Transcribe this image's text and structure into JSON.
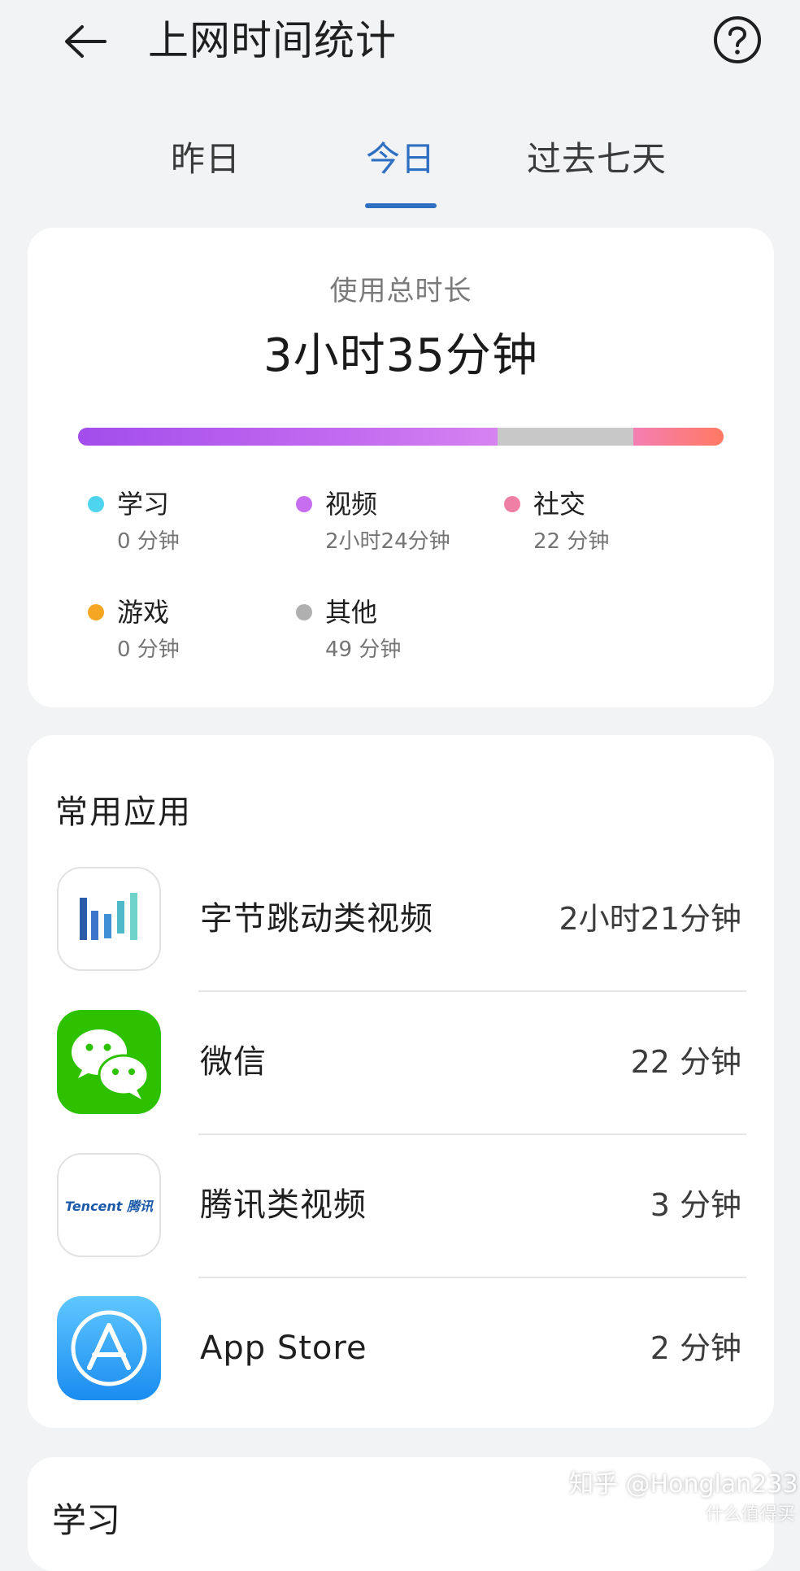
{
  "header": {
    "title": "上网时间统计",
    "back_icon": "arrow-left-icon",
    "help_icon": "question-circle-icon"
  },
  "tabs": [
    {
      "label": "昨日",
      "active": false
    },
    {
      "label": "今日",
      "active": true
    },
    {
      "label": "过去七天",
      "active": false
    }
  ],
  "summary": {
    "total_label": "使用总时长",
    "total_value": "3小时35分钟",
    "bar_segments": [
      {
        "category": "视频",
        "fraction": 0.65,
        "color": "#b35cee"
      },
      {
        "category": "其他",
        "fraction": 0.21,
        "color": "#c8c8c8"
      },
      {
        "category": "社交",
        "fraction": 0.14,
        "color": "#f47e9e"
      }
    ],
    "legend": [
      {
        "name": "学习",
        "time": "0 分钟",
        "color": "#4ed4ef"
      },
      {
        "name": "视频",
        "time": "2小时24分钟",
        "color": "#c76ef0"
      },
      {
        "name": "社交",
        "time": "22 分钟",
        "color": "#f07fa5"
      },
      {
        "name": "游戏",
        "time": "0 分钟",
        "color": "#f5a623"
      },
      {
        "name": "其他",
        "time": "49 分钟",
        "color": "#b0b0b0"
      }
    ]
  },
  "apps": {
    "title": "常用应用",
    "items": [
      {
        "name": "字节跳动类视频",
        "time": "2小时21分钟",
        "icon": "bytedance-bars-icon"
      },
      {
        "name": "微信",
        "time": "22 分钟",
        "icon": "wechat-icon"
      },
      {
        "name": "腾讯类视频",
        "time": "3 分钟",
        "icon": "tencent-logo-icon",
        "icon_text": "Tencent 腾讯"
      },
      {
        "name": "App Store",
        "time": "2 分钟",
        "icon": "app-store-icon"
      }
    ]
  },
  "study": {
    "title": "学习"
  },
  "watermark": {
    "text": "知乎 @Honglan233",
    "sub": "什么值得买"
  }
}
